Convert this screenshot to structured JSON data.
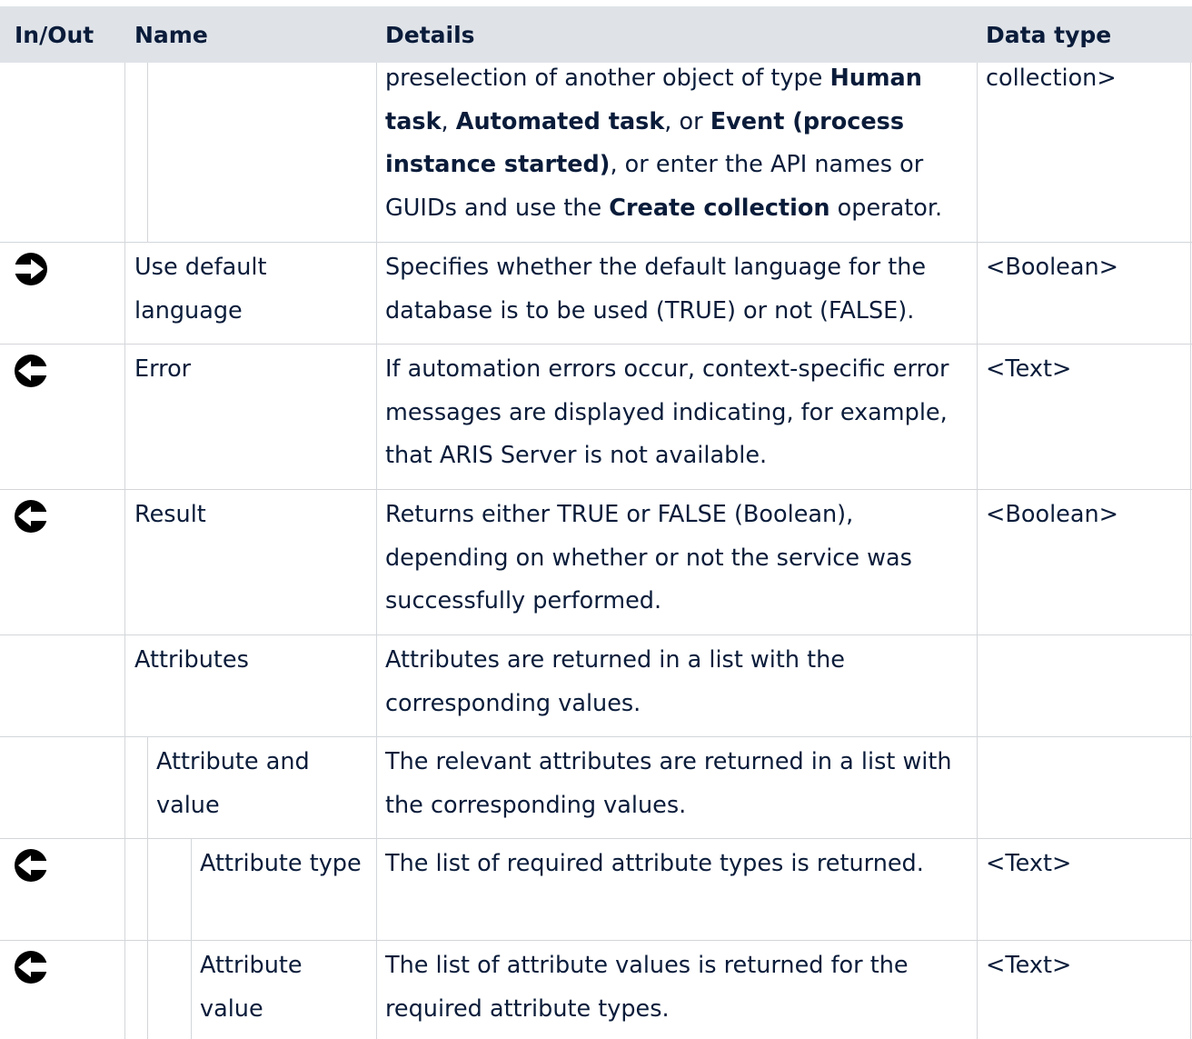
{
  "header": {
    "in_out": "In/Out",
    "name": "Name",
    "details": "Details",
    "data_type": "Data type"
  },
  "rows": [
    {
      "direction": "",
      "direction_icon": "",
      "name": "",
      "details_parts": [
        {
          "text": "preselection of another object of type ",
          "bold": false
        },
        {
          "text": "Human task",
          "bold": true
        },
        {
          "text": ", ",
          "bold": false
        },
        {
          "text": "Automated task",
          "bold": true
        },
        {
          "text": ", or ",
          "bold": false
        },
        {
          "text": "Event (process instance started)",
          "bold": true
        },
        {
          "text": ", or enter the API names or GUIDs and use the ",
          "bold": false
        },
        {
          "text": "Create collection",
          "bold": true
        },
        {
          "text": " operator.",
          "bold": false
        }
      ],
      "data_type": "collection>"
    },
    {
      "direction": "input",
      "direction_icon": "arrow-right-circle-icon",
      "name": "Use default language",
      "details": "Specifies whether the default language for the database is to be used (TRUE) or not (FALSE).",
      "data_type": "<Boolean>"
    },
    {
      "direction": "output",
      "direction_icon": "arrow-left-circle-icon",
      "name": "Error",
      "details": "If automation errors occur, context-specific error messages are displayed indicating, for example, that ARIS Server is not available.",
      "data_type": "<Text>"
    },
    {
      "direction": "output",
      "direction_icon": "arrow-left-circle-icon",
      "name": "Result",
      "details": "Returns either TRUE or FALSE (Boolean), depending on whether or not the service was successfully performed.",
      "data_type": "<Boolean>"
    },
    {
      "direction": "",
      "direction_icon": "",
      "name": "Attributes",
      "details": "Attributes are returned in a list with the corresponding values.",
      "data_type": ""
    },
    {
      "direction": "",
      "direction_icon": "",
      "name": "Attribute and value",
      "details": "The relevant attributes are returned in a list with the corresponding values.",
      "data_type": ""
    },
    {
      "direction": "output",
      "direction_icon": "arrow-left-circle-icon",
      "name": "Attribute type",
      "details": "The list of required attribute types is returned.",
      "data_type": "<Text>"
    },
    {
      "direction": "output",
      "direction_icon": "arrow-left-circle-icon",
      "name": "Attribute value",
      "details": "The list of attribute values is returned for the required attribute types.",
      "data_type": "<Text>"
    }
  ],
  "colors": {
    "header_bg": "#dfe3e8",
    "text": "#0a1c3a",
    "grid": "#d3d6da",
    "icon": "#000000"
  }
}
